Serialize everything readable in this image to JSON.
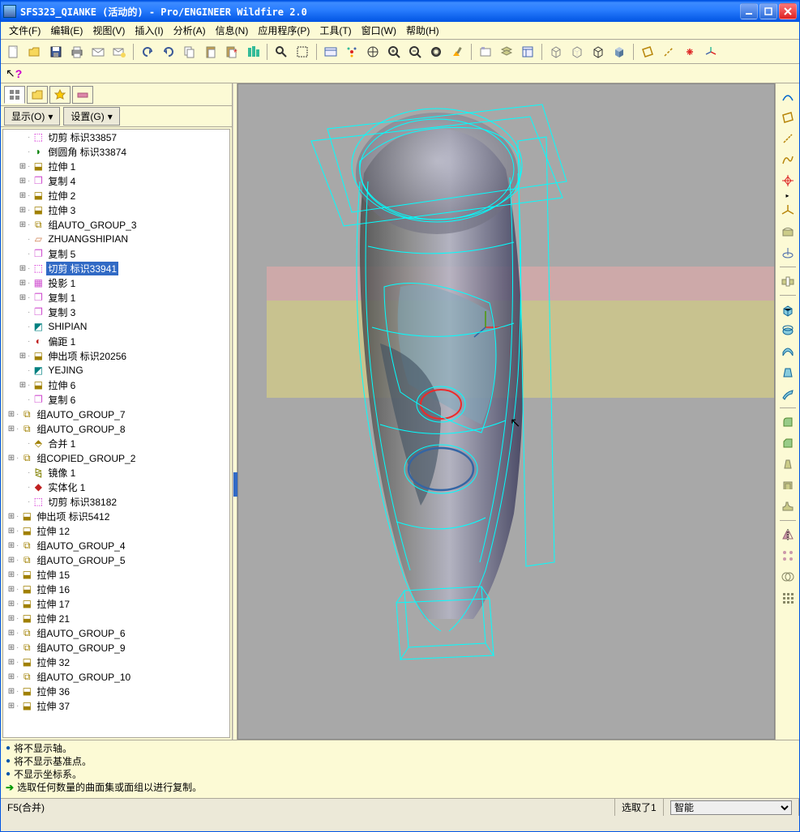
{
  "window": {
    "title": "SFS323_QIANKE (活动的) - Pro/ENGINEER Wildfire 2.0",
    "min": "_",
    "max": "□",
    "close": "×"
  },
  "menus": [
    "文件(F)",
    "编辑(E)",
    "视图(V)",
    "插入(I)",
    "分析(A)",
    "信息(N)",
    "应用程序(P)",
    "工具(T)",
    "窗口(W)",
    "帮助(H)"
  ],
  "help_icon": "?",
  "left_panel": {
    "show_btn": "显示(O)",
    "settings_btn": "设置(G)",
    "tree": [
      {
        "ic": "cut",
        "lbl": "切剪 标识33857",
        "exp": "",
        "d": 1
      },
      {
        "ic": "round",
        "lbl": "倒圆角 标识33874",
        "exp": "",
        "d": 1
      },
      {
        "ic": "extrude",
        "lbl": "拉伸 1",
        "exp": "+",
        "d": 1
      },
      {
        "ic": "copy",
        "lbl": "复制 4",
        "exp": "+",
        "d": 1
      },
      {
        "ic": "extrude",
        "lbl": "拉伸 2",
        "exp": "+",
        "d": 1
      },
      {
        "ic": "extrude",
        "lbl": "拉伸 3",
        "exp": "+",
        "d": 1
      },
      {
        "ic": "group",
        "lbl": "组AUTO_GROUP_3",
        "exp": "+",
        "d": 1
      },
      {
        "ic": "sketch",
        "lbl": "ZHUANGSHIPIAN",
        "exp": "",
        "d": 1
      },
      {
        "ic": "copy",
        "lbl": "复制 5",
        "exp": "",
        "d": 1
      },
      {
        "ic": "cut",
        "lbl": "切剪 标识33941",
        "exp": "+",
        "d": 1,
        "sel": true
      },
      {
        "ic": "proj",
        "lbl": "投影 1",
        "exp": "+",
        "d": 1
      },
      {
        "ic": "copy",
        "lbl": "复制 1",
        "exp": "+",
        "d": 1
      },
      {
        "ic": "copy",
        "lbl": "复制 3",
        "exp": "",
        "d": 1
      },
      {
        "ic": "datum",
        "lbl": "SHIPIAN",
        "exp": "",
        "d": 1
      },
      {
        "ic": "offset",
        "lbl": "偏距 1",
        "exp": "",
        "d": 1
      },
      {
        "ic": "extrude",
        "lbl": "伸出项 标识20256",
        "exp": "+",
        "d": 1
      },
      {
        "ic": "datum",
        "lbl": "YEJING",
        "exp": "",
        "d": 1
      },
      {
        "ic": "extrude",
        "lbl": "拉伸 6",
        "exp": "+",
        "d": 1
      },
      {
        "ic": "copy",
        "lbl": "复制 6",
        "exp": "",
        "d": 1
      },
      {
        "ic": "group",
        "lbl": "组AUTO_GROUP_7",
        "exp": "+",
        "d": 0
      },
      {
        "ic": "group",
        "lbl": "组AUTO_GROUP_8",
        "exp": "+",
        "d": 0
      },
      {
        "ic": "merge",
        "lbl": "合并 1",
        "exp": "",
        "d": 1
      },
      {
        "ic": "group",
        "lbl": "组COPIED_GROUP_2",
        "exp": "+",
        "d": 0
      },
      {
        "ic": "mirror",
        "lbl": "镜像 1",
        "exp": "",
        "d": 1
      },
      {
        "ic": "solid",
        "lbl": "实体化 1",
        "exp": "",
        "d": 1
      },
      {
        "ic": "cut",
        "lbl": "切剪 标识38182",
        "exp": "",
        "d": 1
      },
      {
        "ic": "extrude",
        "lbl": "伸出项 标识5412",
        "exp": "+",
        "d": 0
      },
      {
        "ic": "extrude",
        "lbl": "拉伸 12",
        "exp": "+",
        "d": 0
      },
      {
        "ic": "group",
        "lbl": "组AUTO_GROUP_4",
        "exp": "+",
        "d": 0
      },
      {
        "ic": "group",
        "lbl": "组AUTO_GROUP_5",
        "exp": "+",
        "d": 0
      },
      {
        "ic": "extrude",
        "lbl": "拉伸 15",
        "exp": "+",
        "d": 0
      },
      {
        "ic": "extrude",
        "lbl": "拉伸 16",
        "exp": "+",
        "d": 0
      },
      {
        "ic": "extrude",
        "lbl": "拉伸 17",
        "exp": "+",
        "d": 0
      },
      {
        "ic": "extrude",
        "lbl": "拉伸 21",
        "exp": "+",
        "d": 0
      },
      {
        "ic": "group",
        "lbl": "组AUTO_GROUP_6",
        "exp": "+",
        "d": 0
      },
      {
        "ic": "group",
        "lbl": "组AUTO_GROUP_9",
        "exp": "+",
        "d": 0
      },
      {
        "ic": "extrude",
        "lbl": "拉伸 32",
        "exp": "+",
        "d": 0
      },
      {
        "ic": "group",
        "lbl": "组AUTO_GROUP_10",
        "exp": "+",
        "d": 0
      },
      {
        "ic": "extrude",
        "lbl": "拉伸 36",
        "exp": "+",
        "d": 0
      },
      {
        "ic": "extrude",
        "lbl": "拉伸 37",
        "exp": "+",
        "d": 0
      }
    ]
  },
  "messages": [
    "将不显示轴。",
    "将不显示基准点。",
    "不显示坐标系。"
  ],
  "current_msg": "选取任何数量的曲面集或面组以进行复制。",
  "status": {
    "left": "F5(合并)",
    "selection": "选取了1",
    "filter": "智能"
  },
  "colors": {
    "cyan": "#00ffff",
    "red": "#ef2929",
    "blue": "#3465a4"
  }
}
